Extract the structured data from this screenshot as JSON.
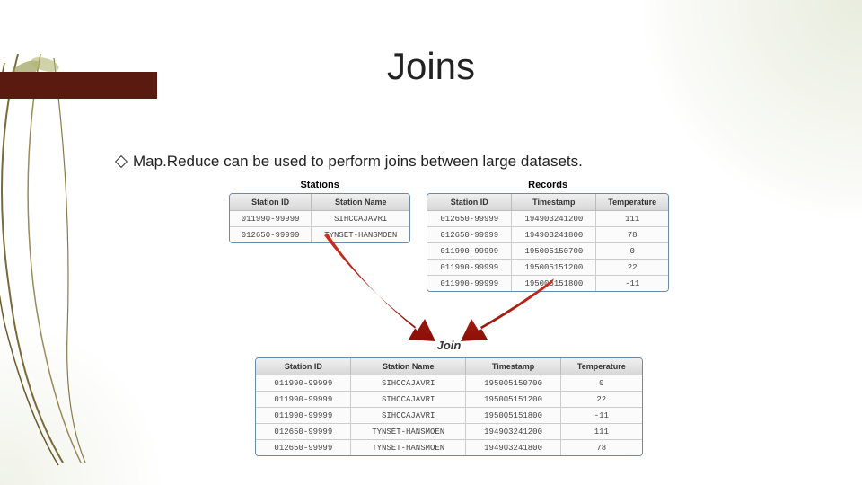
{
  "title": "Joins",
  "bullet": "Map.Reduce can be used to perform joins between large datasets.",
  "join_label": "Join",
  "stations": {
    "title": "Stations",
    "headers": [
      "Station ID",
      "Station Name"
    ],
    "rows": [
      [
        "011990-99999",
        "SIHCCAJAVRI"
      ],
      [
        "012650-99999",
        "TYNSET-HANSMOEN"
      ]
    ]
  },
  "records": {
    "title": "Records",
    "headers": [
      "Station ID",
      "Timestamp",
      "Temperature"
    ],
    "rows": [
      [
        "012650-99999",
        "194903241200",
        "111"
      ],
      [
        "012650-99999",
        "194903241800",
        "78"
      ],
      [
        "011990-99999",
        "195005150700",
        "0"
      ],
      [
        "011990-99999",
        "195005151200",
        "22"
      ],
      [
        "011990-99999",
        "195005151800",
        "-11"
      ]
    ]
  },
  "result": {
    "headers": [
      "Station ID",
      "Station Name",
      "Timestamp",
      "Temperature"
    ],
    "rows": [
      [
        "011990-99999",
        "SIHCCAJAVRI",
        "195005150700",
        "0"
      ],
      [
        "011990-99999",
        "SIHCCAJAVRI",
        "195005151200",
        "22"
      ],
      [
        "011990-99999",
        "SIHCCAJAVRI",
        "195005151800",
        "-11"
      ],
      [
        "012650-99999",
        "TYNSET-HANSMOEN",
        "194903241200",
        "111"
      ],
      [
        "012650-99999",
        "TYNSET-HANSMOEN",
        "194903241800",
        "78"
      ]
    ]
  }
}
